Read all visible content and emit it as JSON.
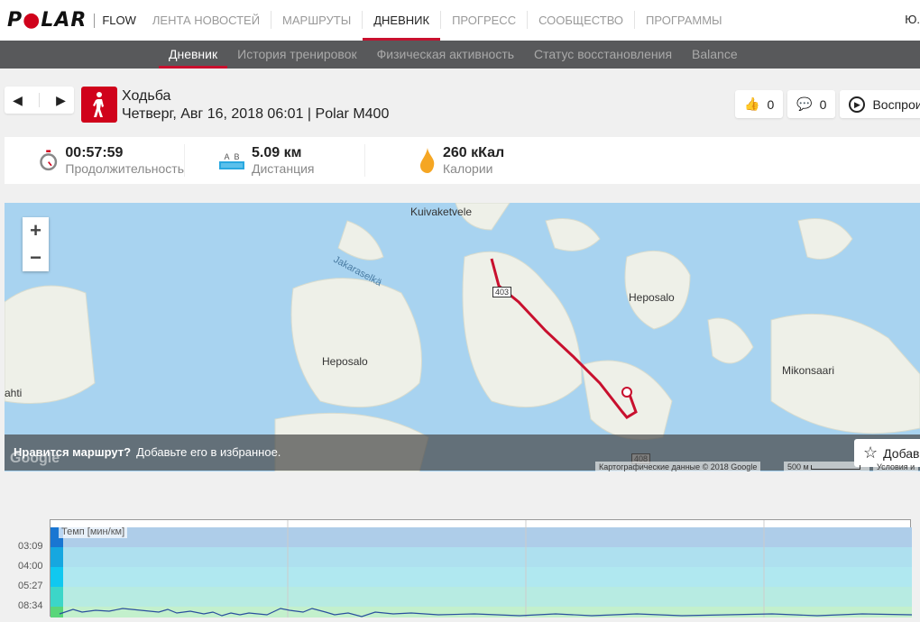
{
  "header": {
    "logo": "POLAR",
    "product": "FLOW",
    "nav": [
      "ЛЕНТА НОВОСТЕЙ",
      "МАРШРУТЫ",
      "ДНЕВНИК",
      "ПРОГРЕСС",
      "СООБЩЕСТВО",
      "ПРОГРАММЫ"
    ],
    "active_nav": "ДНЕВНИК",
    "user": "Ю."
  },
  "subnav": {
    "items": [
      "Дневник",
      "История тренировок",
      "Физическая активность",
      "Статус восстановления",
      "Balance"
    ],
    "active": "Дневник"
  },
  "activity": {
    "sport": "Ходьба",
    "subtitle": "Четверг, Авг 16, 2018 06:01 | Polar M400",
    "likes": "0",
    "comments": "0",
    "play_label": "Воспрои"
  },
  "stats": [
    {
      "value": "00:57:59",
      "label": "Продолжительность",
      "icon": "stopwatch-icon"
    },
    {
      "value": "5.09 км",
      "label": "Дистанция",
      "icon": "distance-icon",
      "a": "A",
      "b": "B"
    },
    {
      "value": "260 кКал",
      "label": "Калории",
      "icon": "flame-icon"
    }
  ],
  "map": {
    "labels": [
      "Kuivaketvele",
      "Jakaraselkä",
      "Heposalo",
      "Heposalo",
      "Mikonsaari",
      "ahti",
      "403",
      "408"
    ],
    "banner_q": "Нравится маршрут?",
    "banner_text": "Добавьте его в избранное.",
    "add_label": "Добав",
    "attribution": "Картографические данные © 2018 Google",
    "scale": "500 м",
    "terms": "Условия и",
    "google": "Google",
    "route_color": "#c8102e"
  },
  "chart": {
    "title": "Темп [мин/км]",
    "y_ticks": [
      "03:09",
      "04:00",
      "05:27",
      "08:34"
    ]
  },
  "colors": {
    "accent": "#c8102e",
    "subnav": "#58595b"
  }
}
